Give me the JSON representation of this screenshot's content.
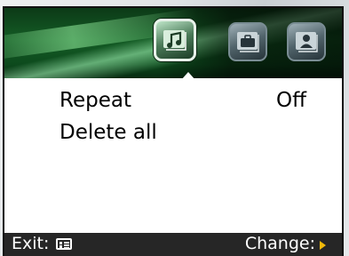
{
  "tabs": [
    {
      "icon": "music-notes-icon",
      "active": true
    },
    {
      "icon": "briefcase-icon",
      "active": false
    },
    {
      "icon": "person-icon",
      "active": false
    }
  ],
  "menu": {
    "items": [
      {
        "label": "Repeat",
        "value": "Off"
      },
      {
        "label": "Delete all",
        "value": ""
      }
    ]
  },
  "softkeys": {
    "left_label": "Exit:",
    "left_icon": "menu-key-icon",
    "right_label": "Change:",
    "right_icon": "arrow-right-icon"
  },
  "colors": {
    "header_green": "#145c25",
    "softkey_bar": "#262626",
    "accent_arrow": "#f2b90a"
  }
}
